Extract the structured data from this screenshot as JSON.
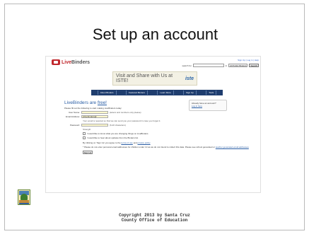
{
  "slide": {
    "title": "Set up an account",
    "copyright_line1": "Copyright 2013 by Santa Cruz",
    "copyright_line2": "County Office of Education"
  },
  "screenshot": {
    "header": {
      "logo_text_red": "Live",
      "logo_text_gray": "Binders",
      "top_links": "Sign Up | Log in | Help",
      "search_label": "search for",
      "search_value": "",
      "search_in": "in",
      "search_scope": "All Public Binders",
      "search_button": "Search"
    },
    "banner": {
      "text": "Visit and Share with Us at ISTE!",
      "brand": "iste"
    },
    "nav": {
      "tabs": [
        "About Binders",
        "Featured Binders",
        "Learn More",
        "Sign Up",
        "Tools"
      ]
    },
    "form": {
      "heading_prefix": "LiveBinders are ",
      "heading_link": "free!",
      "intro": "Please fill out the following to start making LiveBinders today:",
      "username_label": "User Name:",
      "username_value": "",
      "username_hint": "(letters and numbers only please)",
      "email_label": "Email Address:",
      "email_value": "jnlivebinders@",
      "email_note": "Your email is required so that we can send you your password in case you forget it.",
      "password_label": "Password:",
      "password_value": "",
      "password_hint": "(6-20 characters)",
      "strength": "Strength",
      "check1": "I would like to know what you are changing things on LiveBinders",
      "check2": "I would like to hear about updates from the Binders list",
      "terms_prefix": "By clicking on 'Sign Up' you agree to the ",
      "terms_link": "terms of use",
      "terms_mid": " and ",
      "privacy_link": "privacy policy",
      "privacy_note_prefix": "* Please do not enter personal email addresses for children under 13 as we do not intend to collect this data. Please see school generated or ",
      "privacy_note_link": "teacher generated email addresses",
      "signup_button": "Sign Up"
    },
    "sidebox": {
      "line1": "Already have an account?",
      "link": "Log in here"
    }
  },
  "colors": {
    "brand_red": "#c0282d",
    "nav_blue": "#1f3d6e",
    "link_blue": "#2a5ea5"
  }
}
